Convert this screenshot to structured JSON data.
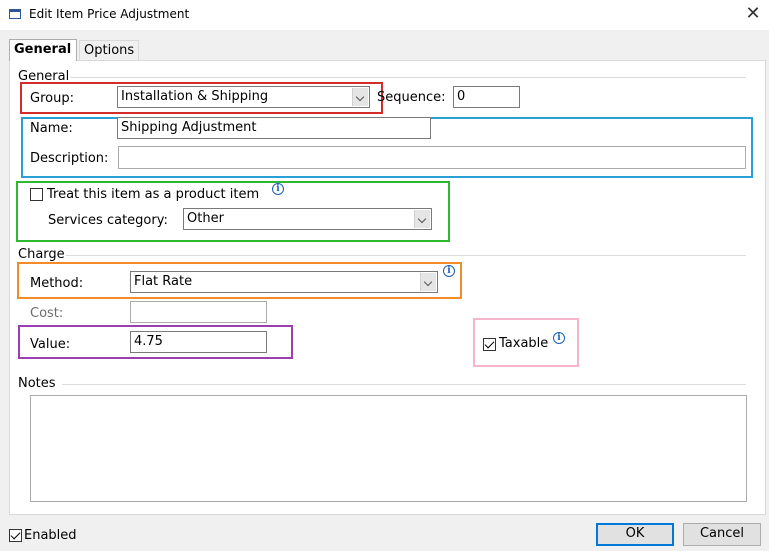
{
  "window": {
    "title": "Edit Item Price Adjustment",
    "close_glyph": "✕"
  },
  "tabs": [
    {
      "label": "General"
    },
    {
      "label": "Options"
    }
  ],
  "general": {
    "section_label": "General",
    "group_label": "Group:",
    "group_value": "Installation & Shipping",
    "sequence_label": "Sequence:",
    "sequence_value": "0",
    "name_label": "Name:",
    "name_value": "Shipping Adjustment",
    "description_label": "Description:",
    "description_value": "",
    "product_item_label": "Treat this item as a product item",
    "product_item_checked": false,
    "services_category_label": "Services category:",
    "services_category_value": "Other"
  },
  "charge": {
    "section_label": "Charge",
    "method_label": "Method:",
    "method_value": "Flat Rate",
    "cost_label": "Cost:",
    "cost_value": "",
    "value_label": "Value:",
    "value_value": "4.75",
    "taxable_label": "Taxable",
    "taxable_checked": true
  },
  "notes": {
    "section_label": "Notes",
    "value": ""
  },
  "footer": {
    "enabled_label": "Enabled",
    "enabled_checked": true,
    "ok_label": "OK",
    "cancel_label": "Cancel"
  },
  "info_glyph": "i",
  "colors": {
    "highlight_group": "#d42b2b",
    "highlight_name_description": "#2a9fd6",
    "highlight_product": "#2eb82e",
    "highlight_method": "#f28c28",
    "highlight_value": "#9b3fb5",
    "highlight_taxable": "#f4b6c8",
    "default_button_border": "#0078d7"
  }
}
